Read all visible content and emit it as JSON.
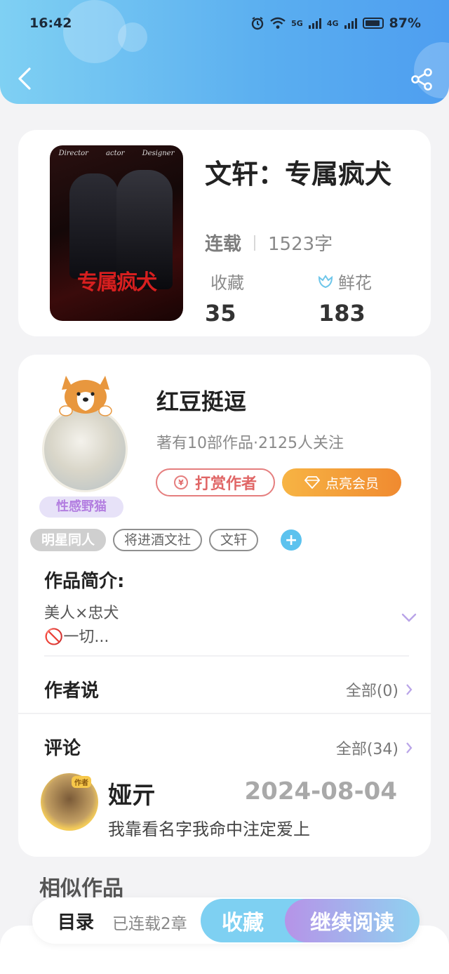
{
  "status_bar": {
    "time": "16:42",
    "net1": "5G",
    "net2": "4G",
    "battery": "87%"
  },
  "book": {
    "title": "文轩：专属疯犬",
    "status": "连载",
    "word_count": "1523字",
    "stats": [
      {
        "label": "收藏",
        "value": "35"
      },
      {
        "label": "鲜花",
        "value": "183"
      }
    ],
    "cover": {
      "credits": [
        "Director",
        "actor",
        "Designer"
      ],
      "title": "专属疯犬"
    }
  },
  "author": {
    "name": "红豆挺逗",
    "summary": "著有10部作品·2125人关注",
    "avatar_tag": "性感野猫",
    "reward_label": "打赏作者",
    "vip_label": "点亮会员"
  },
  "tags": [
    "明星同人",
    "将进酒文社",
    "文轩"
  ],
  "intro": {
    "title": "作品简介:",
    "line1": "美人×忠犬",
    "line2": "🚫一切..."
  },
  "author_says": {
    "title": "作者说",
    "link": "全部(0)"
  },
  "comments": {
    "title": "评论",
    "link": "全部(34)",
    "items": [
      {
        "badge": "作者",
        "name": "娅亓",
        "date": "2024-08-04",
        "text": "我靠看名字我命中注定爱上"
      }
    ]
  },
  "similar": {
    "title": "相似作品"
  },
  "bottom_bar": {
    "toc": "目录",
    "chapters": "已连载2章",
    "favorite": "收藏",
    "continue": "继续阅读"
  },
  "colors": {
    "header_start": "#7fd0f3",
    "header_end": "#4e9ef0",
    "reward": "#e06666",
    "vip": "#f08a30",
    "accent_blue": "#5cc2ee",
    "accent_purple": "#b693e8"
  }
}
